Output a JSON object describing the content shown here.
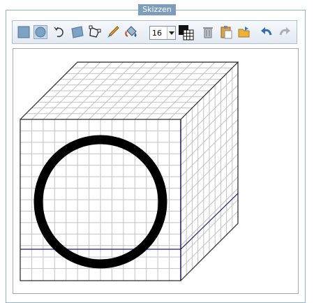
{
  "panel": {
    "title": "Skizzen"
  },
  "toolbar": {
    "buttons": [
      {
        "icon": "rectangle-icon"
      },
      {
        "icon": "ellipse-icon",
        "active": true
      },
      {
        "icon": "rotate-icon"
      },
      {
        "icon": "surface-icon"
      },
      {
        "icon": "polygon-icon"
      },
      {
        "icon": "pen-icon"
      },
      {
        "icon": "fill-bucket-icon"
      },
      {
        "icon": "delete-icon"
      },
      {
        "icon": "paste-icon"
      },
      {
        "icon": "open-folder-icon"
      },
      {
        "icon": "undo-icon"
      },
      {
        "icon": "redo-icon",
        "disabled": true
      }
    ],
    "font_size": "16"
  }
}
